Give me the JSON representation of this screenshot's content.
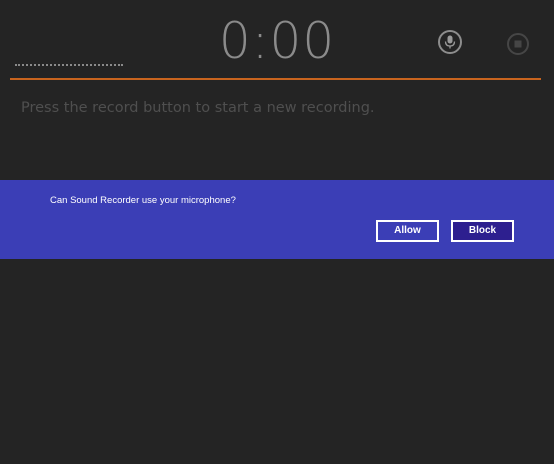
{
  "recorder": {
    "timer": "0:00",
    "hint": "Press the record button to start a new recording."
  },
  "controls": {
    "record_icon": "microphone-icon",
    "stop_icon": "stop-icon"
  },
  "dialog": {
    "message": "Can Sound Recorder use your microphone?",
    "allow_label": "Allow",
    "block_label": "Block"
  },
  "colors": {
    "background": "#242424",
    "accent_rule": "#c8641e",
    "dialog_background": "#3b3eb6",
    "block_button": "#2d1f8f"
  }
}
